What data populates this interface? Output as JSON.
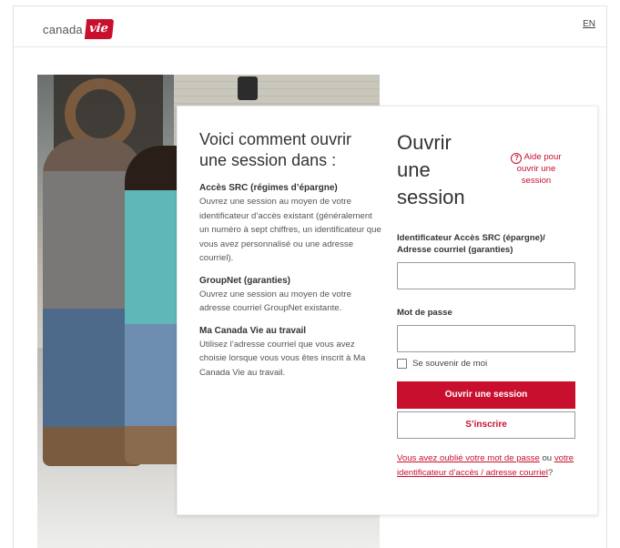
{
  "header": {
    "logo_text": "canada",
    "logo_mark": "vie",
    "lang_link": "EN"
  },
  "info": {
    "title": "Voici comment ouvrir une session dans :",
    "sections": [
      {
        "heading": "Accès SRC (régimes d’épargne)",
        "text": "Ouvrez une session au moyen de votre identificateur d’accès existant (généralement un numéro à sept chiffres, un identificateur que vous avez personnalisé ou une adresse courriel)."
      },
      {
        "heading": "GroupNet (garanties)",
        "text": "Ouvrez une session au moyen de votre adresse courriel GroupNet existante."
      },
      {
        "heading": "Ma Canada Vie au travail",
        "text": "Utilisez l’adresse courriel que vous avez choisie lorsque vous vous êtes inscrit à Ma Canada Vie au travail."
      }
    ]
  },
  "form": {
    "title": "Ouvrir une session",
    "help_icon": "?",
    "help_label": "Aide pour ouvrir une session",
    "id_label": "Identificateur Accès SRC (épargne)/ Adresse courriel (garanties)",
    "id_value": "",
    "password_label": "Mot de passe",
    "password_value": "",
    "remember_label": "Se souvenir de moi",
    "remember_checked": false,
    "login_button": "Ouvrir une session",
    "register_button": "S’inscrire",
    "forgot_password_link": "Vous avez oublié votre mot de passe",
    "forgot_or": " ou ",
    "forgot_id_link": "votre identificateur d’accès / adresse courriel",
    "forgot_end": "?"
  },
  "colors": {
    "brand": "#c8102e",
    "text": "#333333",
    "border": "#9a9a9a"
  }
}
